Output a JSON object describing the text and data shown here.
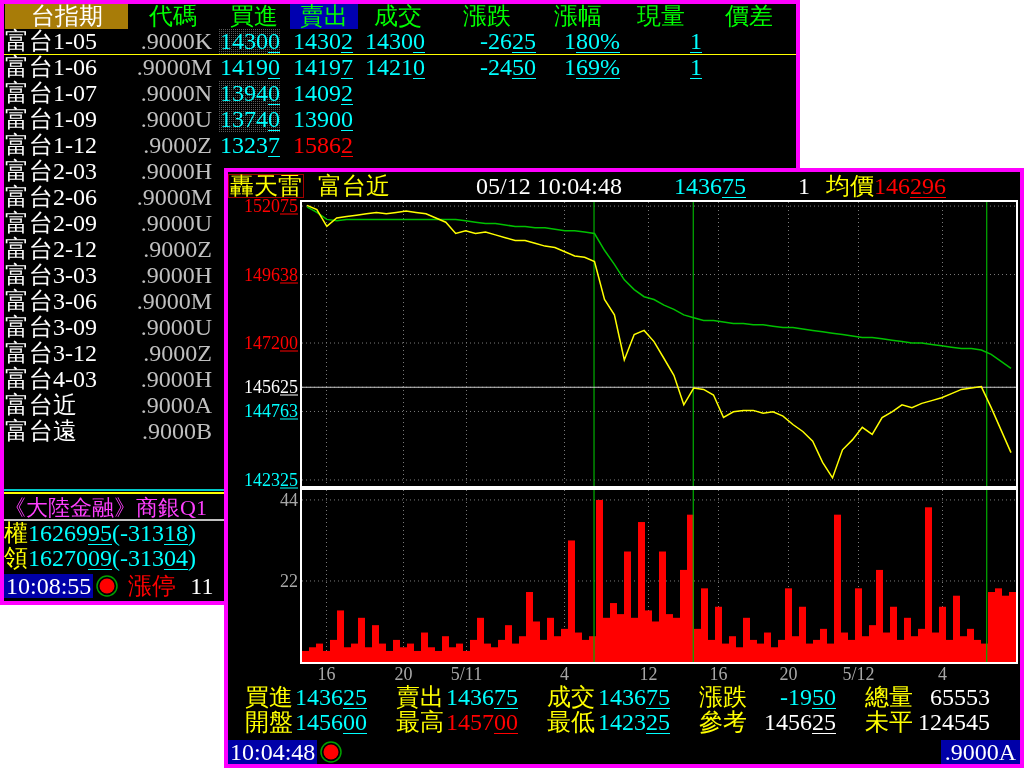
{
  "quote_window": {
    "market": "台指期",
    "columns": [
      {
        "label": "代碼",
        "selected": false
      },
      {
        "label": "買進",
        "selected": false
      },
      {
        "label": "賣出",
        "selected": true
      },
      {
        "label": "成交",
        "selected": false
      },
      {
        "label": "漲跌",
        "selected": false
      },
      {
        "label": "漲幅",
        "selected": false
      },
      {
        "label": "現量",
        "selected": false
      },
      {
        "label": "價差",
        "selected": false
      }
    ],
    "rows": [
      {
        "name": "富台1-05",
        "code": ".9000K",
        "selected": true,
        "buy": {
          "parts": [
            "1430",
            {
              "underline": "0"
            }
          ],
          "color": "#00ffff",
          "highlighted": true
        },
        "sell": {
          "parts": [
            "1430",
            {
              "underline": "2"
            }
          ],
          "color": "#00ffff"
        },
        "trade": {
          "parts": [
            "1430",
            {
              "underline": "0"
            }
          ],
          "color": "#00ffff"
        },
        "change": {
          "parts": [
            "-26",
            {
              "underline": "25"
            }
          ],
          "color": "#00ffff"
        },
        "change_pct": {
          "parts": [
            "1",
            {
              "underline": "80%"
            }
          ],
          "color": "#00ffff"
        },
        "volume": {
          "parts": [
            {
              "underline": "1"
            }
          ],
          "color": "#00ffff"
        }
      },
      {
        "name": "富台1-06",
        "code": ".9000M",
        "selected": false,
        "buy": {
          "parts": [
            "1419",
            {
              "underline": "0"
            }
          ],
          "color": "#00ffff",
          "highlighted": false
        },
        "sell": {
          "parts": [
            "1419",
            {
              "underline": "7"
            }
          ],
          "color": "#00ffff"
        },
        "trade": {
          "parts": [
            "1421",
            {
              "underline": "0"
            }
          ],
          "color": "#00ffff"
        },
        "change": {
          "parts": [
            "-24",
            {
              "underline": "50"
            }
          ],
          "color": "#00ffff"
        },
        "change_pct": {
          "parts": [
            "1",
            {
              "underline": "69%"
            }
          ],
          "color": "#00ffff"
        },
        "volume": {
          "parts": [
            {
              "underline": "1"
            }
          ],
          "color": "#00ffff"
        }
      },
      {
        "name": "富台1-07",
        "code": ".9000N",
        "selected": false,
        "buy": {
          "parts": [
            "1394",
            {
              "underline": "0"
            }
          ],
          "color": "#00ffff",
          "highlighted": true
        },
        "sell": {
          "parts": [
            "1409",
            {
              "underline": "2"
            }
          ],
          "color": "#00ffff"
        }
      },
      {
        "name": "富台1-09",
        "code": ".9000U",
        "selected": false,
        "buy": {
          "parts": [
            "1374",
            {
              "underline": "0"
            }
          ],
          "color": "#00ffff",
          "highlighted": true
        },
        "sell": {
          "parts": [
            "1390",
            {
              "underline": "0"
            }
          ],
          "color": "#00ffff"
        }
      },
      {
        "name": "富台1-12",
        "code": ".9000Z",
        "selected": false,
        "buy": {
          "parts": [
            "1323",
            {
              "underline": "7"
            }
          ],
          "color": "#00ffff",
          "highlighted": false
        },
        "sell": {
          "parts": [
            "1586",
            {
              "underline": "2"
            }
          ],
          "color": "#ff0000"
        }
      },
      {
        "name": "富台2-03",
        "code": ".9000H",
        "selected": false
      },
      {
        "name": "富台2-06",
        "code": ".9000M",
        "selected": false
      },
      {
        "name": "富台2-09",
        "code": ".9000U",
        "selected": false
      },
      {
        "name": "富台2-12",
        "code": ".9000Z",
        "selected": false
      },
      {
        "name": "富台3-03",
        "code": ".9000H",
        "selected": false
      },
      {
        "name": "富台3-06",
        "code": ".9000M",
        "selected": false
      },
      {
        "name": "富台3-09",
        "code": ".9000U",
        "selected": false
      },
      {
        "name": "富台3-12",
        "code": ".9000Z",
        "selected": false
      },
      {
        "name": "富台4-03",
        "code": ".9000H",
        "selected": false
      },
      {
        "name": "富台近",
        "code": ".9000A",
        "selected": false
      },
      {
        "name": "富台遠",
        "code": ".9000B",
        "selected": false
      }
    ],
    "ticker": "《大陸金融》商銀Q1",
    "indices": [
      {
        "label": "權",
        "value": {
          "parts": [
            "16269",
            {
              "underline": "95"
            }
          ],
          "color": "#00ffff"
        },
        "change": {
          "parts": [
            "(-313",
            {
              "underline": "18"
            },
            ")"
          ],
          "color": "#00ffff"
        }
      },
      {
        "label": "領",
        "value": {
          "parts": [
            "16270",
            {
              "underline": "09"
            }
          ],
          "color": "#00ffff"
        },
        "change": {
          "parts": [
            "(-313",
            {
              "underline": "04"
            },
            ")"
          ],
          "color": "#00ffff"
        }
      }
    ],
    "status": {
      "time": "10:08:55",
      "alert": "漲停",
      "count": "11"
    }
  },
  "chart_window": {
    "app_name": "轟天雷",
    "symbol": "富台近",
    "datetime": "05/12 10:04:48",
    "last": {
      "parts": [
        "1436",
        {
          "underline": "75"
        }
      ]
    },
    "last_volume": "1",
    "average_label": "均價",
    "average": {
      "parts": [
        "146",
        {
          "underline": "296"
        }
      ]
    },
    "price_chart": {
      "chart_data": {
        "type": "line",
        "categories": [
          null,
          null,
          null,
          null,
          null,
          null,
          null,
          null,
          null,
          null,
          null,
          null,
          null,
          null,
          null,
          null,
          null,
          null,
          null,
          null,
          null,
          null,
          null,
          null,
          null,
          null,
          null,
          null,
          null,
          null,
          null,
          null,
          null,
          null,
          null,
          null,
          null,
          null,
          null,
          null,
          null,
          null,
          null,
          null,
          null,
          null,
          null,
          null,
          null,
          null,
          null,
          null,
          null,
          null,
          null,
          null,
          null,
          null,
          null,
          null,
          null,
          null,
          null,
          null,
          null,
          null,
          null,
          null,
          null,
          null,
          null,
          null
        ],
        "series": [
          {
            "color": "#ffff00",
            "values": [
              152100,
              151950,
              151350,
              151650,
              151700,
              151750,
              151800,
              151850,
              151800,
              151850,
              151900,
              151850,
              151800,
              151650,
              151500,
              151100,
              151200,
              151100,
              151150,
              151050,
              150950,
              150850,
              150850,
              150750,
              150650,
              150600,
              150450,
              150300,
              150250,
              150100,
              148750,
              148200,
              146600,
              147500,
              147650,
              147250,
              146650,
              146050,
              145000,
              145600,
              145550,
              145350,
              144550,
              144750,
              144800,
              144800,
              144700,
              144750,
              144600,
              144300,
              144050,
              143700,
              142950,
              142400,
              143400,
              143750,
              144200,
              143950,
              144550,
              144750,
              145000,
              144900,
              145050,
              145150,
              145250,
              145400,
              145550,
              145600,
              145650,
              144900,
              144100,
              143300
            ]
          },
          {
            "color": "#00c000",
            "values": [
              152050,
              151850,
              151600,
              151550,
              151600,
              151600,
              151600,
              151600,
              151600,
              151600,
              151600,
              151600,
              151600,
              151600,
              151600,
              151600,
              151550,
              151500,
              151450,
              151450,
              151400,
              151350,
              151350,
              151300,
              151300,
              151250,
              151200,
              151200,
              151150,
              151100,
              150500,
              150000,
              149450,
              149100,
              148850,
              148750,
              148550,
              148400,
              148200,
              148100,
              148000,
              148000,
              147950,
              147900,
              147900,
              147850,
              147850,
              147800,
              147750,
              147750,
              147700,
              147650,
              147600,
              147550,
              147500,
              147450,
              147400,
              147400,
              147350,
              147300,
              147250,
              147200,
              147200,
              147150,
              147100,
              147050,
              147000,
              147000,
              146950,
              146800,
              146550,
              146300
            ]
          }
        ],
        "ylim": [
          142110,
          152220
        ],
        "yticks": [
          152075,
          149638,
          147200,
          145625,
          144763,
          142325
        ],
        "grid": true,
        "ref_lines": [
          {
            "axis": "y",
            "value": 145625
          }
        ]
      }
    },
    "volume_chart": {
      "chart_data": {
        "type": "bar",
        "categories": [
          null,
          null,
          null,
          "16",
          null,
          null,
          null,
          null,
          null,
          null,
          null,
          null,
          null,
          null,
          "20",
          null,
          null,
          null,
          null,
          null,
          null,
          null,
          null,
          "5/11",
          null,
          null,
          null,
          null,
          null,
          null,
          null,
          null,
          null,
          null,
          null,
          null,
          null,
          "4",
          null,
          null,
          null,
          null,
          null,
          null,
          null,
          null,
          null,
          null,
          null,
          "12",
          null,
          null,
          null,
          null,
          null,
          null,
          null,
          null,
          null,
          "16",
          null,
          null,
          null,
          null,
          null,
          null,
          null,
          null,
          null,
          "20",
          null,
          null,
          null,
          null,
          null,
          null,
          null,
          null,
          null,
          "5/12",
          null,
          null,
          null,
          null,
          null,
          null,
          null,
          null,
          null,
          null,
          null,
          "4",
          null,
          null,
          null,
          null,
          null,
          null,
          null,
          null,
          null,
          null
        ],
        "series": [
          {
            "color": "#ff0000",
            "values": [
              3,
              4,
              5,
              3,
              6,
              14,
              4,
              5,
              12,
              4,
              10,
              5,
              3,
              6,
              4,
              5,
              3,
              8,
              4,
              3,
              7,
              4,
              5,
              3,
              6,
              12,
              5,
              4,
              6,
              10,
              5,
              7,
              19,
              11,
              6,
              12,
              7,
              9,
              33,
              8,
              6,
              7,
              44,
              12,
              16,
              13,
              30,
              12,
              38,
              14,
              11,
              30,
              13,
              12,
              25,
              40,
              9,
              20,
              6,
              15,
              5,
              7,
              4,
              12,
              6,
              5,
              8,
              4,
              6,
              20,
              7,
              15,
              5,
              6,
              9,
              5,
              40,
              8,
              6,
              20,
              7,
              10,
              25,
              8,
              15,
              6,
              12,
              7,
              9,
              42,
              8,
              15,
              6,
              18,
              7,
              9,
              6,
              5,
              19,
              20,
              18,
              19
            ]
          }
        ],
        "ylim": [
          0,
          46.7
        ],
        "yticks": [
          44,
          22
        ],
        "grid": true
      }
    },
    "stats": [
      {
        "label": "買進",
        "value": {
          "parts": [
            "1436",
            {
              "underline": "25"
            }
          ],
          "color": "#00ffff"
        }
      },
      {
        "label": "賣出",
        "value": {
          "parts": [
            "1436",
            {
              "underline": "75"
            }
          ],
          "color": "#00ffff"
        }
      },
      {
        "label": "成交",
        "value": {
          "parts": [
            "1436",
            {
              "underline": "75"
            }
          ],
          "color": "#00ffff"
        }
      },
      {
        "label": "漲跌",
        "value": {
          "parts": [
            "-19",
            {
              "underline": "50"
            }
          ],
          "color": "#00ffff"
        }
      },
      {
        "label": "總量",
        "value": {
          "parts": [
            "65553"
          ],
          "color": "#ffffff"
        }
      },
      {
        "label": "開盤",
        "value": {
          "parts": [
            "1456",
            {
              "underline": "00"
            }
          ],
          "color": "#00ffff"
        }
      },
      {
        "label": "最高",
        "value": {
          "parts": [
            "1457",
            {
              "underline": "00"
            }
          ],
          "color": "#ff0000"
        }
      },
      {
        "label": "最低",
        "value": {
          "parts": [
            "1423",
            {
              "underline": "25"
            }
          ],
          "color": "#00ffff"
        }
      },
      {
        "label": "參考",
        "value": {
          "parts": [
            "1456",
            {
              "underline": "25"
            }
          ],
          "color": "#ffffff"
        }
      },
      {
        "label": "未平",
        "value": {
          "parts": [
            "124545"
          ],
          "color": "#ffffff"
        }
      }
    ],
    "status": {
      "time": "10:04:48",
      "code": ".9000A"
    }
  }
}
